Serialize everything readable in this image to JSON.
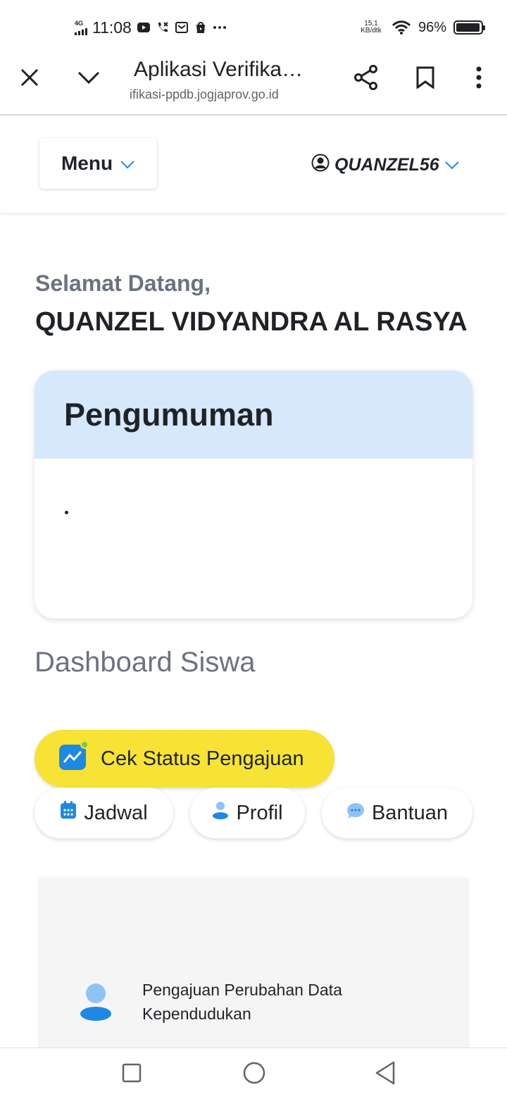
{
  "status_bar": {
    "network": "4G",
    "time": "11:08",
    "speed_value": "15,1",
    "speed_unit": "KB/dtk",
    "battery": "96%",
    "battery_level": 0.96,
    "icons": [
      "youtube-icon",
      "call-icon",
      "message-icon",
      "store-icon",
      "more-icon",
      "wifi-icon",
      "battery-icon"
    ]
  },
  "browser": {
    "title": "Aplikasi Verifika…",
    "url": "ifikasi-ppdb.jogjaprov.go.id",
    "icons": [
      "close-icon",
      "chevron-down-icon",
      "share-icon",
      "bookmark-icon",
      "more-vert-icon"
    ]
  },
  "header": {
    "menu_label": "Menu",
    "username": "QUANZEL56"
  },
  "welcome": {
    "greeting": "Selamat Datang,",
    "name": "QUANZEL VIDYANDRA AL RASYA"
  },
  "announcement": {
    "title": "Pengumuman",
    "body": "."
  },
  "dashboard": {
    "title": "Dashboard Siswa",
    "primary_button": "Cek Status Pengajuan",
    "pills": {
      "jadwal": "Jadwal",
      "profil": "Profil",
      "bantuan": "Bantuan"
    }
  },
  "service_card": {
    "line1": "Pengajuan Perubahan Data",
    "line2": "Kependudukan"
  },
  "colors": {
    "accent_blue": "#1e88e5",
    "announce_header": "#d6e8fb",
    "status_button": "#f6e335"
  }
}
